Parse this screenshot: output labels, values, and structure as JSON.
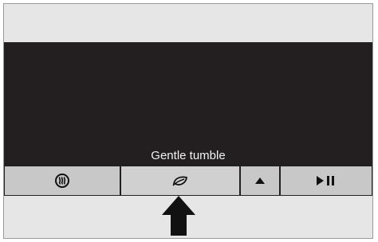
{
  "display": {
    "mode_label": "Gentle tumble"
  },
  "buttons": [
    {
      "name": "heat-button",
      "icon": "heat-dry-icon"
    },
    {
      "name": "gentle-tumble-button",
      "icon": "leaf-icon"
    },
    {
      "name": "up-button",
      "icon": "triangle-up-icon"
    },
    {
      "name": "play-pause-button",
      "icon": "play-pause-icon"
    }
  ],
  "callout": {
    "icon": "arrow-up-icon",
    "target": "gentle-tumble-button"
  },
  "colors": {
    "frame": "#e6e6e6",
    "screen": "#231f20",
    "button": "#c8c8c8",
    "label_text": "#f2f2f2"
  }
}
